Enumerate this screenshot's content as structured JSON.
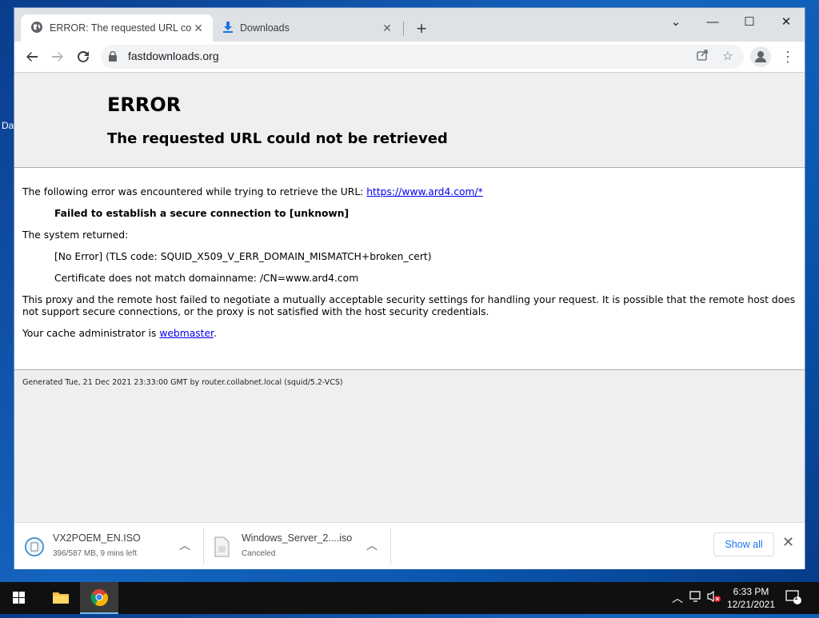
{
  "browser": {
    "tabs": [
      {
        "title": "ERROR: The requested URL could not be retrieved",
        "icon": "globe-icon"
      },
      {
        "title": "Downloads",
        "icon": "download-icon"
      }
    ],
    "address": "fastdownloads.org"
  },
  "page": {
    "title": "ERROR",
    "subtitle": "The requested URL could not be retrieved",
    "intro": "The following error was encountered while trying to retrieve the URL:",
    "url_link": "https://www.ard4.com/*",
    "failure": "Failed to establish a secure connection to [unknown]",
    "system_returned": "The system returned:",
    "no_error": "[No Error] (TLS code: SQUID_X509_V_ERR_DOMAIN_MISMATCH+broken_cert)",
    "cert_msg": "Certificate does not match domainname: /CN=www.ard4.com",
    "explanation": "This proxy and the remote host failed to negotiate a mutually acceptable security settings for handling your request. It is possible that the remote host does not support secure connections, or the proxy is not satisfied with the host security credentials.",
    "admin_prefix": "Your cache administrator is",
    "admin_link": "webmaster",
    "admin_suffix": ".",
    "generated": "Generated Tue, 21 Dec 2021 23:33:00 GMT by router.collabnet.local (squid/5.2-VCS)"
  },
  "downloads": [
    {
      "name": "VX2POEM_EN.ISO",
      "status": "396/587 MB, 9 mins left"
    },
    {
      "name": "Windows_Server_2....iso",
      "status": "Canceled"
    }
  ],
  "shelf": {
    "show_all": "Show all"
  },
  "desktop": {
    "edge_text": "Da"
  },
  "taskbar": {
    "time": "6:33 PM",
    "date": "12/21/2021",
    "notifications": "1"
  }
}
